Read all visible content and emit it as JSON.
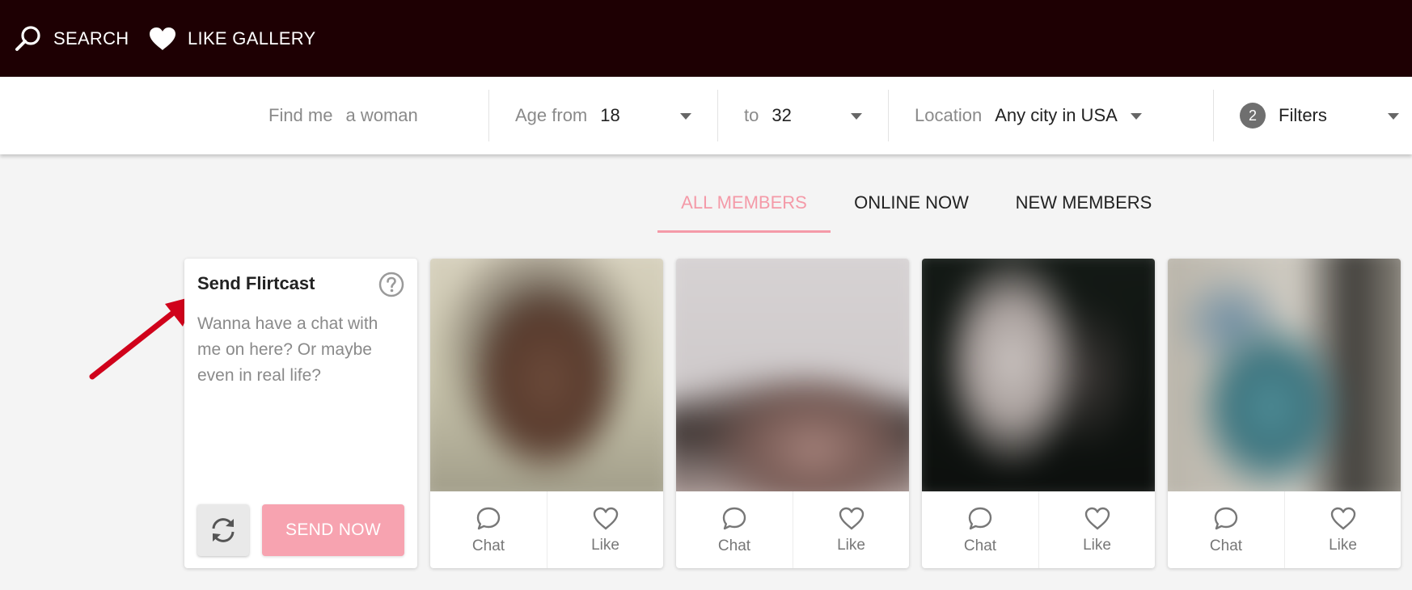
{
  "nav": {
    "search_label": "SEARCH",
    "like_gallery_label": "LIKE GALLERY",
    "search_icon": "search-icon",
    "heart_icon": "heart-icon"
  },
  "filters": {
    "find_me_label": "Find me",
    "find_me_value": "a woman",
    "age_from_label": "Age from",
    "age_from_value": "18",
    "age_to_label": "to",
    "age_to_value": "32",
    "location_label": "Location",
    "location_value": "Any city in USA",
    "filters_count": "2",
    "filters_label": "Filters"
  },
  "tabs": [
    {
      "label": "ALL MEMBERS",
      "active": true
    },
    {
      "label": "ONLINE NOW",
      "active": false
    },
    {
      "label": "NEW MEMBERS",
      "active": false
    }
  ],
  "flirtcast": {
    "title": "Send Flirtcast",
    "message": "Wanna have a chat with me on here? Or maybe even in real life?",
    "send_label": "SEND NOW"
  },
  "members": [
    {
      "chat_label": "Chat",
      "like_label": "Like"
    },
    {
      "chat_label": "Chat",
      "like_label": "Like"
    },
    {
      "chat_label": "Chat",
      "like_label": "Like"
    },
    {
      "chat_label": "Chat",
      "like_label": "Like"
    }
  ],
  "colors": {
    "topbar": "#1e0003",
    "accent_pink": "#f49aa8",
    "send_button": "#f7a3b0",
    "annotation_arrow": "#d0021b"
  }
}
